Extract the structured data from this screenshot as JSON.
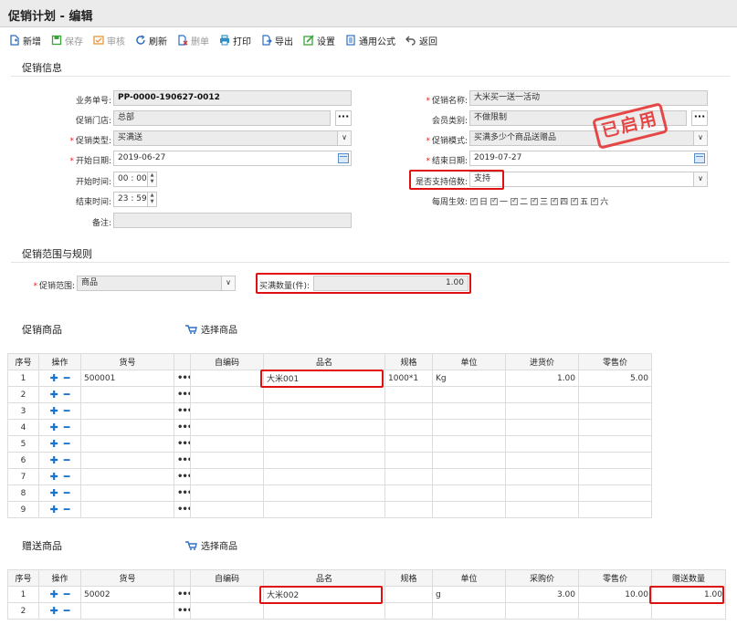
{
  "window": {
    "title": "促销计划 - 编辑"
  },
  "toolbar": {
    "buttons": [
      {
        "label": "新增",
        "icon": "new-doc-icon",
        "color": "#2f6fc4",
        "disabled": false
      },
      {
        "label": "保存",
        "icon": "save-icon",
        "color": "#3aa33a",
        "disabled": true
      },
      {
        "label": "审核",
        "icon": "review-icon",
        "color": "#e8963a",
        "disabled": true
      },
      {
        "label": "刷新",
        "icon": "refresh-icon",
        "color": "#2f6fc4",
        "disabled": false
      },
      {
        "label": "删单",
        "icon": "delete-doc-icon",
        "color": "#d23a3a",
        "disabled": true
      },
      {
        "label": "打印",
        "icon": "print-icon",
        "color": "#2f8fc4",
        "disabled": false
      },
      {
        "label": "导出",
        "icon": "export-icon",
        "color": "#2f6fc4",
        "disabled": false
      },
      {
        "label": "设置",
        "icon": "settings-icon",
        "color": "#3aa33a",
        "disabled": false
      },
      {
        "label": "通用公式",
        "icon": "formula-icon",
        "color": "#2f6fc4",
        "disabled": false
      },
      {
        "label": "返回",
        "icon": "back-icon",
        "color": "#555555",
        "disabled": false
      }
    ]
  },
  "promo_info": {
    "section_title": "促销信息",
    "doc_no_label": "业务单号:",
    "doc_no": "PP-0000-190627-0012",
    "store_label": "促销门店:",
    "store": "总部",
    "type_label": "促销类型:",
    "type": "买满送",
    "start_date_label": "开始日期:",
    "start_date": "2019-06-27",
    "start_time_label": "开始时间:",
    "start_time_h": "00",
    "start_time_m": "00",
    "end_time_label": "结束时间:",
    "end_time_h": "23",
    "end_time_m": "59",
    "remark_label": "备注:",
    "remark": "",
    "name_label": "促销名称:",
    "name": "大米买一送一活动",
    "member_label": "会员类别:",
    "member": "不做限制",
    "mode_label": "促销模式:",
    "mode": "买满多少个商品送赠品",
    "end_date_label": "结束日期:",
    "end_date": "2019-07-27",
    "multiple_label": "是否支持倍数:",
    "multiple": "支持",
    "weekly_label": "每周生效:",
    "weekdays": [
      "日",
      "一",
      "二",
      "三",
      "四",
      "五",
      "六"
    ],
    "stamp": "已启用"
  },
  "rules": {
    "section_title": "促销范围与规则",
    "scope_label": "促销范围:",
    "scope": "商品",
    "qty_label": "买满数量(件):",
    "qty": "1.00"
  },
  "promo_goods": {
    "section_title": "促销商品",
    "select_label": "选择商品",
    "headers": [
      "序号",
      "操作",
      "货号",
      "",
      "自编码",
      "品名",
      "规格",
      "单位",
      "进货价",
      "零售价"
    ],
    "rows": [
      {
        "no": "1",
        "code": "500001",
        "self": "",
        "name": "大米001",
        "spec": "1000*1",
        "unit": "Kg",
        "buy": "1.00",
        "retail": "5.00"
      },
      {
        "no": "2",
        "code": "",
        "self": "",
        "name": "",
        "spec": "",
        "unit": "",
        "buy": "",
        "retail": ""
      },
      {
        "no": "3",
        "code": "",
        "self": "",
        "name": "",
        "spec": "",
        "unit": "",
        "buy": "",
        "retail": ""
      },
      {
        "no": "4",
        "code": "",
        "self": "",
        "name": "",
        "spec": "",
        "unit": "",
        "buy": "",
        "retail": ""
      },
      {
        "no": "5",
        "code": "",
        "self": "",
        "name": "",
        "spec": "",
        "unit": "",
        "buy": "",
        "retail": ""
      },
      {
        "no": "6",
        "code": "",
        "self": "",
        "name": "",
        "spec": "",
        "unit": "",
        "buy": "",
        "retail": ""
      },
      {
        "no": "7",
        "code": "",
        "self": "",
        "name": "",
        "spec": "",
        "unit": "",
        "buy": "",
        "retail": ""
      },
      {
        "no": "8",
        "code": "",
        "self": "",
        "name": "",
        "spec": "",
        "unit": "",
        "buy": "",
        "retail": ""
      },
      {
        "no": "9",
        "code": "",
        "self": "",
        "name": "",
        "spec": "",
        "unit": "",
        "buy": "",
        "retail": ""
      }
    ]
  },
  "gift_goods": {
    "section_title": "赠送商品",
    "select_label": "选择商品",
    "headers": [
      "序号",
      "操作",
      "货号",
      "",
      "自编码",
      "品名",
      "规格",
      "单位",
      "采购价",
      "零售价",
      "赠送数量"
    ],
    "rows": [
      {
        "no": "1",
        "code": "50002",
        "self": "",
        "name": "大米002",
        "spec": "",
        "unit": "g",
        "buy": "3.00",
        "retail": "10.00",
        "qty": "1.00"
      },
      {
        "no": "2",
        "code": "",
        "self": "",
        "name": "",
        "spec": "",
        "unit": "",
        "buy": "",
        "retail": "",
        "qty": ""
      }
    ]
  },
  "colors": {
    "accent": "#1a73c8",
    "highlight": "#e01010",
    "stamp": "#e53a3a"
  }
}
